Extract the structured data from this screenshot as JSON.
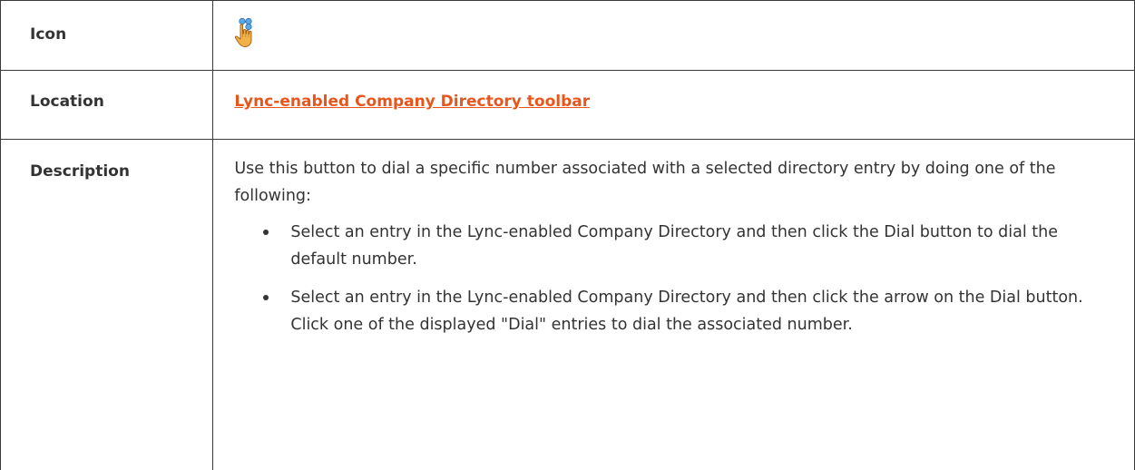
{
  "rows": {
    "icon": {
      "label": "Icon",
      "icon_name": "hand-pointer-dial-icon"
    },
    "location": {
      "label": "Location",
      "link_text": "Lync-enabled Company Directory toolbar",
      "link_color": "#e8561c"
    },
    "description": {
      "label": "Description",
      "intro": "Use this button to dial a specific number associated with a selected directory entry by doing one of the following:",
      "bullets": [
        "Select an entry in the Lync-enabled Company Directory and then click the Dial button to dial the default number.",
        "Select an entry in the Lync-enabled Company Directory and then click the arrow on the Dial button. Click one of the displayed \"Dial\" entries to dial the associated number."
      ]
    }
  }
}
